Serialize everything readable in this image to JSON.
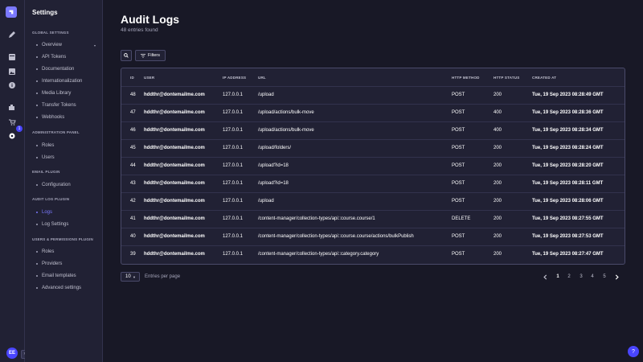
{
  "app": {
    "badge_count": "1",
    "avatar_initials": "EE",
    "expand_label": "›",
    "help_label": "?"
  },
  "subnav": {
    "title": "Settings",
    "sections": [
      {
        "title": "Global Settings",
        "items": [
          "Overview",
          "API Tokens",
          "Documentation",
          "Internationalization",
          "Media Library",
          "Transfer Tokens",
          "Webhooks"
        ]
      },
      {
        "title": "Administration Panel",
        "items": [
          "Roles",
          "Users"
        ]
      },
      {
        "title": "Email Plugin",
        "items": [
          "Configuration"
        ]
      },
      {
        "title": "Audit Log Plugin",
        "items": [
          "Logs",
          "Log Settings"
        ]
      },
      {
        "title": "Users & Permissions Plugin",
        "items": [
          "Roles",
          "Providers",
          "Email templates",
          "Advanced settings"
        ]
      }
    ],
    "active_item": "Logs"
  },
  "main": {
    "title": "Audit Logs",
    "subtitle": "48 entries found",
    "filters_label": "Filters"
  },
  "table": {
    "headers": [
      "ID",
      "User",
      "IP Address",
      "URL",
      "HTTP Method",
      "HTTP Status",
      "Created At"
    ],
    "rows": [
      {
        "id": "48",
        "user": "hddthr@dontemailme.com",
        "ip": "127.0.0.1",
        "url": "/upload",
        "method": "POST",
        "status": "200",
        "created": "Tue, 19 Sep 2023 08:28:49 GMT"
      },
      {
        "id": "47",
        "user": "hddthr@dontemailme.com",
        "ip": "127.0.0.1",
        "url": "/upload/actions/bulk-move",
        "method": "POST",
        "status": "400",
        "created": "Tue, 19 Sep 2023 08:28:36 GMT"
      },
      {
        "id": "46",
        "user": "hddthr@dontemailme.com",
        "ip": "127.0.0.1",
        "url": "/upload/actions/bulk-move",
        "method": "POST",
        "status": "400",
        "created": "Tue, 19 Sep 2023 08:28:34 GMT"
      },
      {
        "id": "45",
        "user": "hddthr@dontemailme.com",
        "ip": "127.0.0.1",
        "url": "/upload/folders/",
        "method": "POST",
        "status": "200",
        "created": "Tue, 19 Sep 2023 08:28:24 GMT"
      },
      {
        "id": "44",
        "user": "hddthr@dontemailme.com",
        "ip": "127.0.0.1",
        "url": "/upload?id=18",
        "method": "POST",
        "status": "200",
        "created": "Tue, 19 Sep 2023 08:28:20 GMT"
      },
      {
        "id": "43",
        "user": "hddthr@dontemailme.com",
        "ip": "127.0.0.1",
        "url": "/upload?id=18",
        "method": "POST",
        "status": "200",
        "created": "Tue, 19 Sep 2023 08:28:11 GMT"
      },
      {
        "id": "42",
        "user": "hddthr@dontemailme.com",
        "ip": "127.0.0.1",
        "url": "/upload",
        "method": "POST",
        "status": "200",
        "created": "Tue, 19 Sep 2023 08:28:06 GMT"
      },
      {
        "id": "41",
        "user": "hddthr@dontemailme.com",
        "ip": "127.0.0.1",
        "url": "/content-manager/collection-types/api::course.course/1",
        "method": "DELETE",
        "status": "200",
        "created": "Tue, 19 Sep 2023 08:27:55 GMT"
      },
      {
        "id": "40",
        "user": "hddthr@dontemailme.com",
        "ip": "127.0.0.1",
        "url": "/content-manager/collection-types/api::course.course/actions/bulkPublish",
        "method": "POST",
        "status": "200",
        "created": "Tue, 19 Sep 2023 08:27:53 GMT"
      },
      {
        "id": "39",
        "user": "hddthr@dontemailme.com",
        "ip": "127.0.0.1",
        "url": "/content-manager/collection-types/api::category.category",
        "method": "POST",
        "status": "200",
        "created": "Tue, 19 Sep 2023 08:27:47 GMT"
      }
    ]
  },
  "footer": {
    "per_page_value": "10",
    "per_page_label": "Entries per page",
    "pages": [
      "1",
      "2",
      "3",
      "4",
      "5"
    ],
    "current_page": "1"
  },
  "colors": {
    "background": "#181826",
    "panel": "#212134",
    "accent": "#4945ff",
    "active_link": "#7b79ff",
    "border": "#32324d"
  }
}
